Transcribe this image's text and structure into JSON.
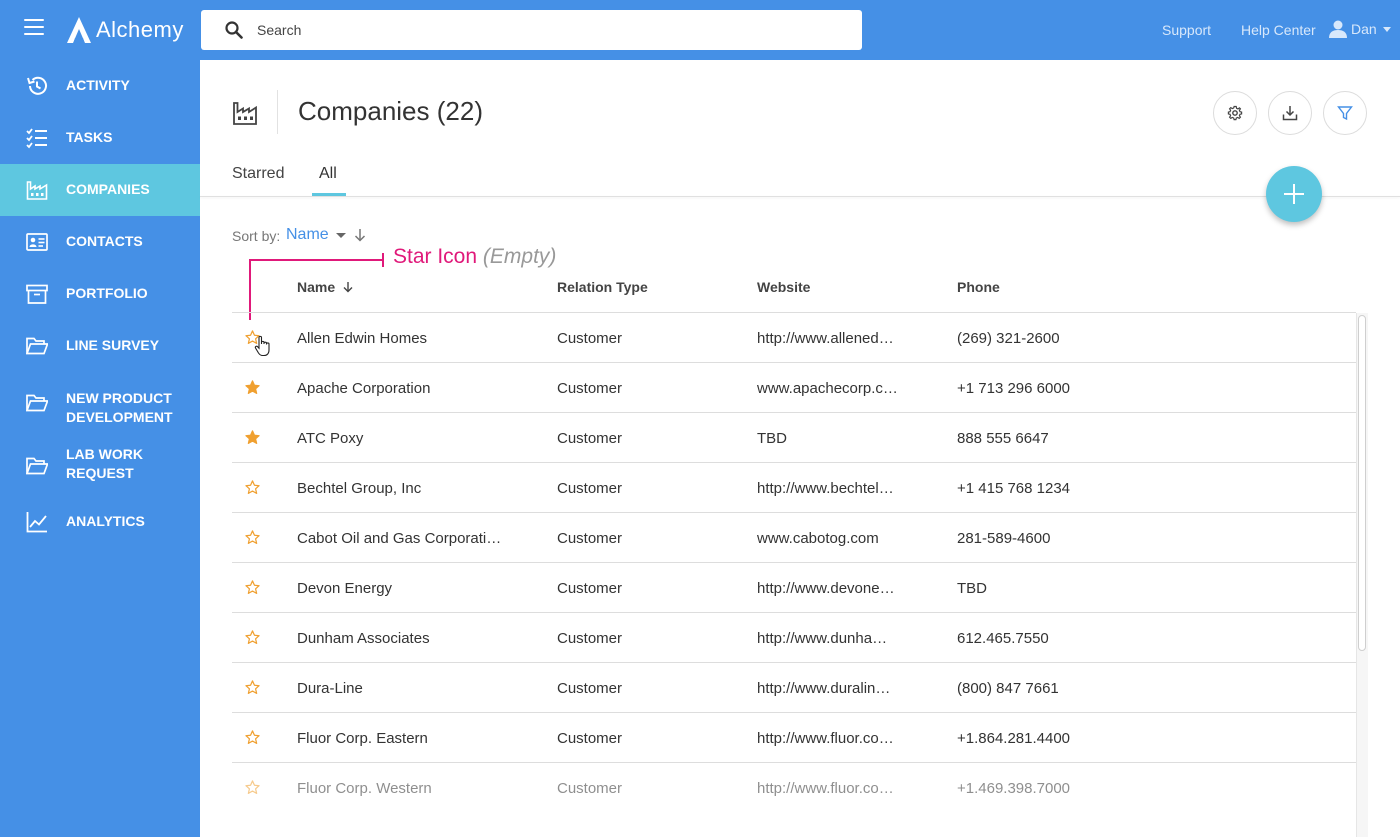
{
  "app": {
    "name": "Alchemy"
  },
  "search": {
    "placeholder": "Search"
  },
  "top_links": {
    "support": "Support",
    "help_center": "Help Center",
    "user_name": "Dan"
  },
  "sidebar": {
    "items": [
      {
        "label": "ACTIVITY",
        "icon": "history-icon",
        "active": false
      },
      {
        "label": "TASKS",
        "icon": "checklist-icon",
        "active": false
      },
      {
        "label": "COMPANIES",
        "icon": "factory-icon",
        "active": true
      },
      {
        "label": "CONTACTS",
        "icon": "contact-card-icon",
        "active": false
      },
      {
        "label": "PORTFOLIO",
        "icon": "archive-box-icon",
        "active": false
      },
      {
        "label": "LINE SURVEY",
        "icon": "folder-open-icon",
        "active": false
      },
      {
        "label": "NEW PRODUCT DEVELOPMENT",
        "icon": "folder-open-icon",
        "active": false
      },
      {
        "label": "LAB WORK REQUEST",
        "icon": "folder-open-icon",
        "active": false
      },
      {
        "label": "ANALYTICS",
        "icon": "line-chart-icon",
        "active": false
      }
    ]
  },
  "page": {
    "title": "Companies (22)"
  },
  "toolbar": {
    "settings_icon": "gear-icon",
    "export_icon": "download-icon",
    "filter_icon": "filter-icon"
  },
  "tabs": [
    {
      "label": "Starred",
      "active": false
    },
    {
      "label": "All",
      "active": true
    }
  ],
  "sort": {
    "label": "Sort by:",
    "value": "Name",
    "direction": "descending-arrow"
  },
  "annotation": {
    "title": "Star Icon",
    "note": "(Empty)"
  },
  "table": {
    "columns": [
      "Name",
      "Relation Type",
      "Website",
      "Phone"
    ],
    "rows": [
      {
        "starred": false,
        "name": "Allen Edwin Homes",
        "relation": "Customer",
        "website": "http://www.allened…",
        "phone": "(269) 321-2600"
      },
      {
        "starred": true,
        "name": "Apache Corporation",
        "relation": "Customer",
        "website": "www.apachecorp.c…",
        "phone": "+1 713 296 6000"
      },
      {
        "starred": true,
        "name": "ATC Poxy",
        "relation": "Customer",
        "website": "TBD",
        "phone": "888 555 6647"
      },
      {
        "starred": false,
        "name": "Bechtel Group, Inc",
        "relation": "Customer",
        "website": "http://www.bechtel…",
        "phone": "+1 415 768 1234"
      },
      {
        "starred": false,
        "name": "Cabot Oil and Gas Corporati…",
        "relation": "Customer",
        "website": "www.cabotog.com",
        "phone": "281-589-4600"
      },
      {
        "starred": false,
        "name": "Devon Energy",
        "relation": "Customer",
        "website": "http://www.devone…",
        "phone": "TBD"
      },
      {
        "starred": false,
        "name": "Dunham Associates",
        "relation": "Customer",
        "website": "http://www.dunha…",
        "phone": "612.465.7550"
      },
      {
        "starred": false,
        "name": "Dura-Line",
        "relation": "Customer",
        "website": "http://www.duralin…",
        "phone": "(800) 847 7661"
      },
      {
        "starred": false,
        "name": "Fluor Corp. Eastern",
        "relation": "Customer",
        "website": "http://www.fluor.co…",
        "phone": "+1.864.281.4400"
      },
      {
        "starred": false,
        "name": "Fluor Corp. Western",
        "relation": "Customer",
        "website": "http://www.fluor.co…",
        "phone": "+1.469.398.7000"
      }
    ]
  },
  "colors": {
    "primary": "#4590e6",
    "accent": "#5ec7e0",
    "star": "#f0a030",
    "annotation": "#e0197a"
  }
}
